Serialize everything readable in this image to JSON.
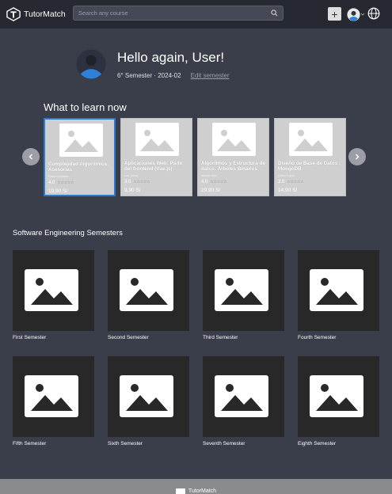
{
  "app": {
    "name": "TutorMatch"
  },
  "search": {
    "placeholder": "Search any course"
  },
  "greeting": {
    "title": "Hello again, User!",
    "semester": "6° Semester · 2024-02",
    "edit_label": "Edit semester"
  },
  "learn": {
    "title": "What to learn now",
    "courses": [
      {
        "title": "Complejidad Algorítmica: Asesorías",
        "author": "Pedro Gonzales",
        "rating": "4.0",
        "stars": "☆☆☆☆☆",
        "price": "19,90 S/"
      },
      {
        "title": "Aplicaciones Web: Parte del frontend (Vue.js)",
        "author": "Luis Torres",
        "rating": "3.0",
        "stars": "☆☆☆☆☆",
        "price": "9,90 S/"
      },
      {
        "title": "Algoritmos y Estructura de datos: Árboles Binarios",
        "author": "Mariela Ruiz",
        "rating": "4.0",
        "stars": "☆☆☆☆☆",
        "price": "29,90 S/"
      },
      {
        "title": "Diseño de Base de Datos : MongoDB",
        "author": "Carlos Lopez",
        "rating": "3.0",
        "stars": "☆☆☆☆☆",
        "price": "14,90 S/"
      }
    ]
  },
  "semesters": {
    "title": "Software Engineering Semesters",
    "items": [
      "First Semester",
      "Second Semester",
      "Third Semester",
      "Fourth Semester",
      "Fifth Semester",
      "Sixth Semester",
      "Seventh Semester",
      "Eighth Semester"
    ]
  },
  "footer": {
    "text": "TutorMatch"
  },
  "colors": {
    "background": "#3a3d4a",
    "topbar": "#262932",
    "selected_border": "#2a7bd6",
    "avatar_blue": "#2f80d8"
  },
  "icons": [
    "logo-icon",
    "search-icon",
    "plus-icon",
    "user-avatar-icon",
    "globe-icon",
    "chevron-left-icon",
    "chevron-right-icon",
    "image-placeholder-icon"
  ]
}
